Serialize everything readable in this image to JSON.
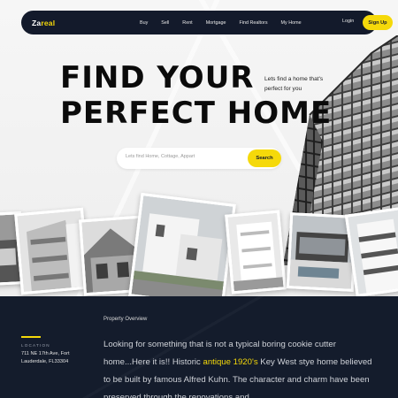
{
  "brand": {
    "name_part1": "Za",
    "name_part2": "real",
    "accent_color": "#f5d90a",
    "dark_color": "#131a2b"
  },
  "nav": {
    "links": [
      "Buy",
      "Sell",
      "Rent",
      "Mortgage",
      "Find Realtors",
      "My Home"
    ],
    "login": "Login",
    "signup": "Sign Up"
  },
  "hero": {
    "headline_line1": "FIND YOUR",
    "headline_line2": "PERFECT HOME",
    "tagline": "Lets find a home that's perfect for you",
    "search_placeholder": "Lets find Home, Cottage, Appart",
    "search_button": "Search"
  },
  "overview": {
    "title": "Property Overview",
    "location_label": "LOCATION",
    "address": "711 NE 17th Ave, Fort Lauderdale, FL33304",
    "desc_part1": "Looking for something that is not a typical boring cookie cutter home...Here it is!! Historic ",
    "desc_highlight": "antique 1920's",
    "desc_part2": " Key West stye home believed to be built by famous Alfred Kuhn. The character and charm have been preserved through the renovations and"
  }
}
